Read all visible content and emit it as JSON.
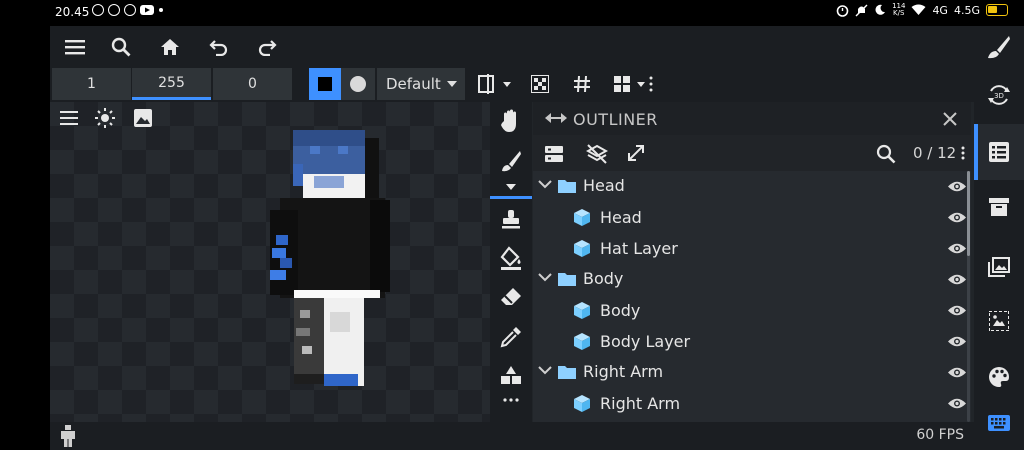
{
  "statusbar": {
    "time": "20.45",
    "net_speed_top": "114",
    "net_speed_bottom": "K/S",
    "net1": "4G",
    "net2": "4.5G"
  },
  "toolbar": {
    "icons": [
      "menu-icon",
      "search-icon",
      "home-icon",
      "undo-icon",
      "redo-icon",
      "paintbrush-icon"
    ]
  },
  "fields": {
    "value1": "1",
    "value2": "255",
    "value3": "0"
  },
  "blend_mode": {
    "selected": "Default"
  },
  "colors": {
    "accent": "#3e90ff",
    "primary_color": "#000000",
    "secondary_color": "#d9d9d9",
    "folder": "#8ed0ff",
    "cube": "#7ccfff"
  },
  "outliner": {
    "title": "OUTLINER",
    "count": "0 / 12",
    "items": [
      {
        "type": "group",
        "label": "Head"
      },
      {
        "type": "cube",
        "label": "Head"
      },
      {
        "type": "cube",
        "label": "Hat Layer"
      },
      {
        "type": "group",
        "label": "Body"
      },
      {
        "type": "cube",
        "label": "Body"
      },
      {
        "type": "cube",
        "label": "Body Layer"
      },
      {
        "type": "group",
        "label": "Right Arm"
      },
      {
        "type": "cube",
        "label": "Right Arm"
      }
    ]
  },
  "status": {
    "fps": "60 FPS"
  },
  "rightbar": {
    "icons": [
      "rotate-3d-icon",
      "outliner-icon",
      "archive-icon",
      "images-icon",
      "texture-icon",
      "palette-icon",
      "keyboard-icon"
    ],
    "rotate_label": "3D"
  }
}
